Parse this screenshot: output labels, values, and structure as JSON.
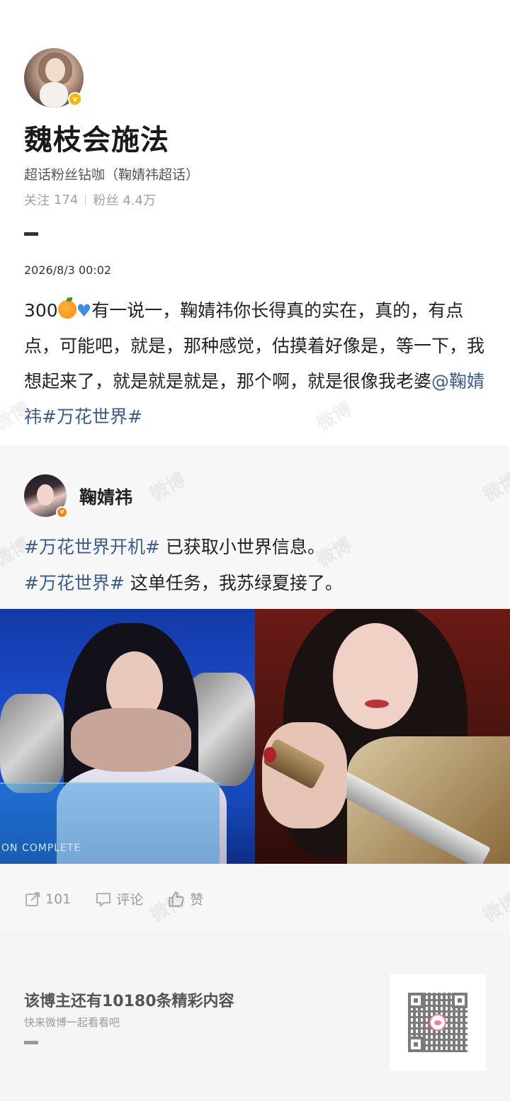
{
  "watermark": {
    "text": "微博"
  },
  "profile": {
    "name": "魏枝会施法",
    "subtitle": "超话粉丝钻咖（鞠婧祎超话）",
    "following_label": "关注",
    "following_count": "174",
    "followers_label": "粉丝",
    "followers_count": "4.4万",
    "badge": "v"
  },
  "post": {
    "date": "2026/8/3 00:02",
    "text_prefix": "300",
    "text_main": "有一说一，鞠婧祎你长得真的实在，真的，有点点，可能吧，就是，那种感觉，估摸着好像是，等一下，我想起来了，就是就是就是，那个啊，就是很像我老婆",
    "mention": "@鞠婧祎",
    "topic": "#万花世界#"
  },
  "repost": {
    "author": "鞠婧祎",
    "badge": "v",
    "line1_topic": "#万花世界开机#",
    "line1_text": " 已获取小世界信息。",
    "line2_topic": "#万花世界#",
    "line2_text": " 这单任务，我苏绿夏接了。",
    "image_left_caption": "ON COMPLETE",
    "actions": {
      "repost_count": "101",
      "comment_label": "评论",
      "like_label": "赞"
    }
  },
  "footer": {
    "title": "该博主还有10180条精彩内容",
    "subtitle": "快来微博一起看看吧"
  },
  "colors": {
    "link": "#3b5c8f",
    "verified_gold": "#f7b500",
    "verified_orange": "#ff8200"
  }
}
